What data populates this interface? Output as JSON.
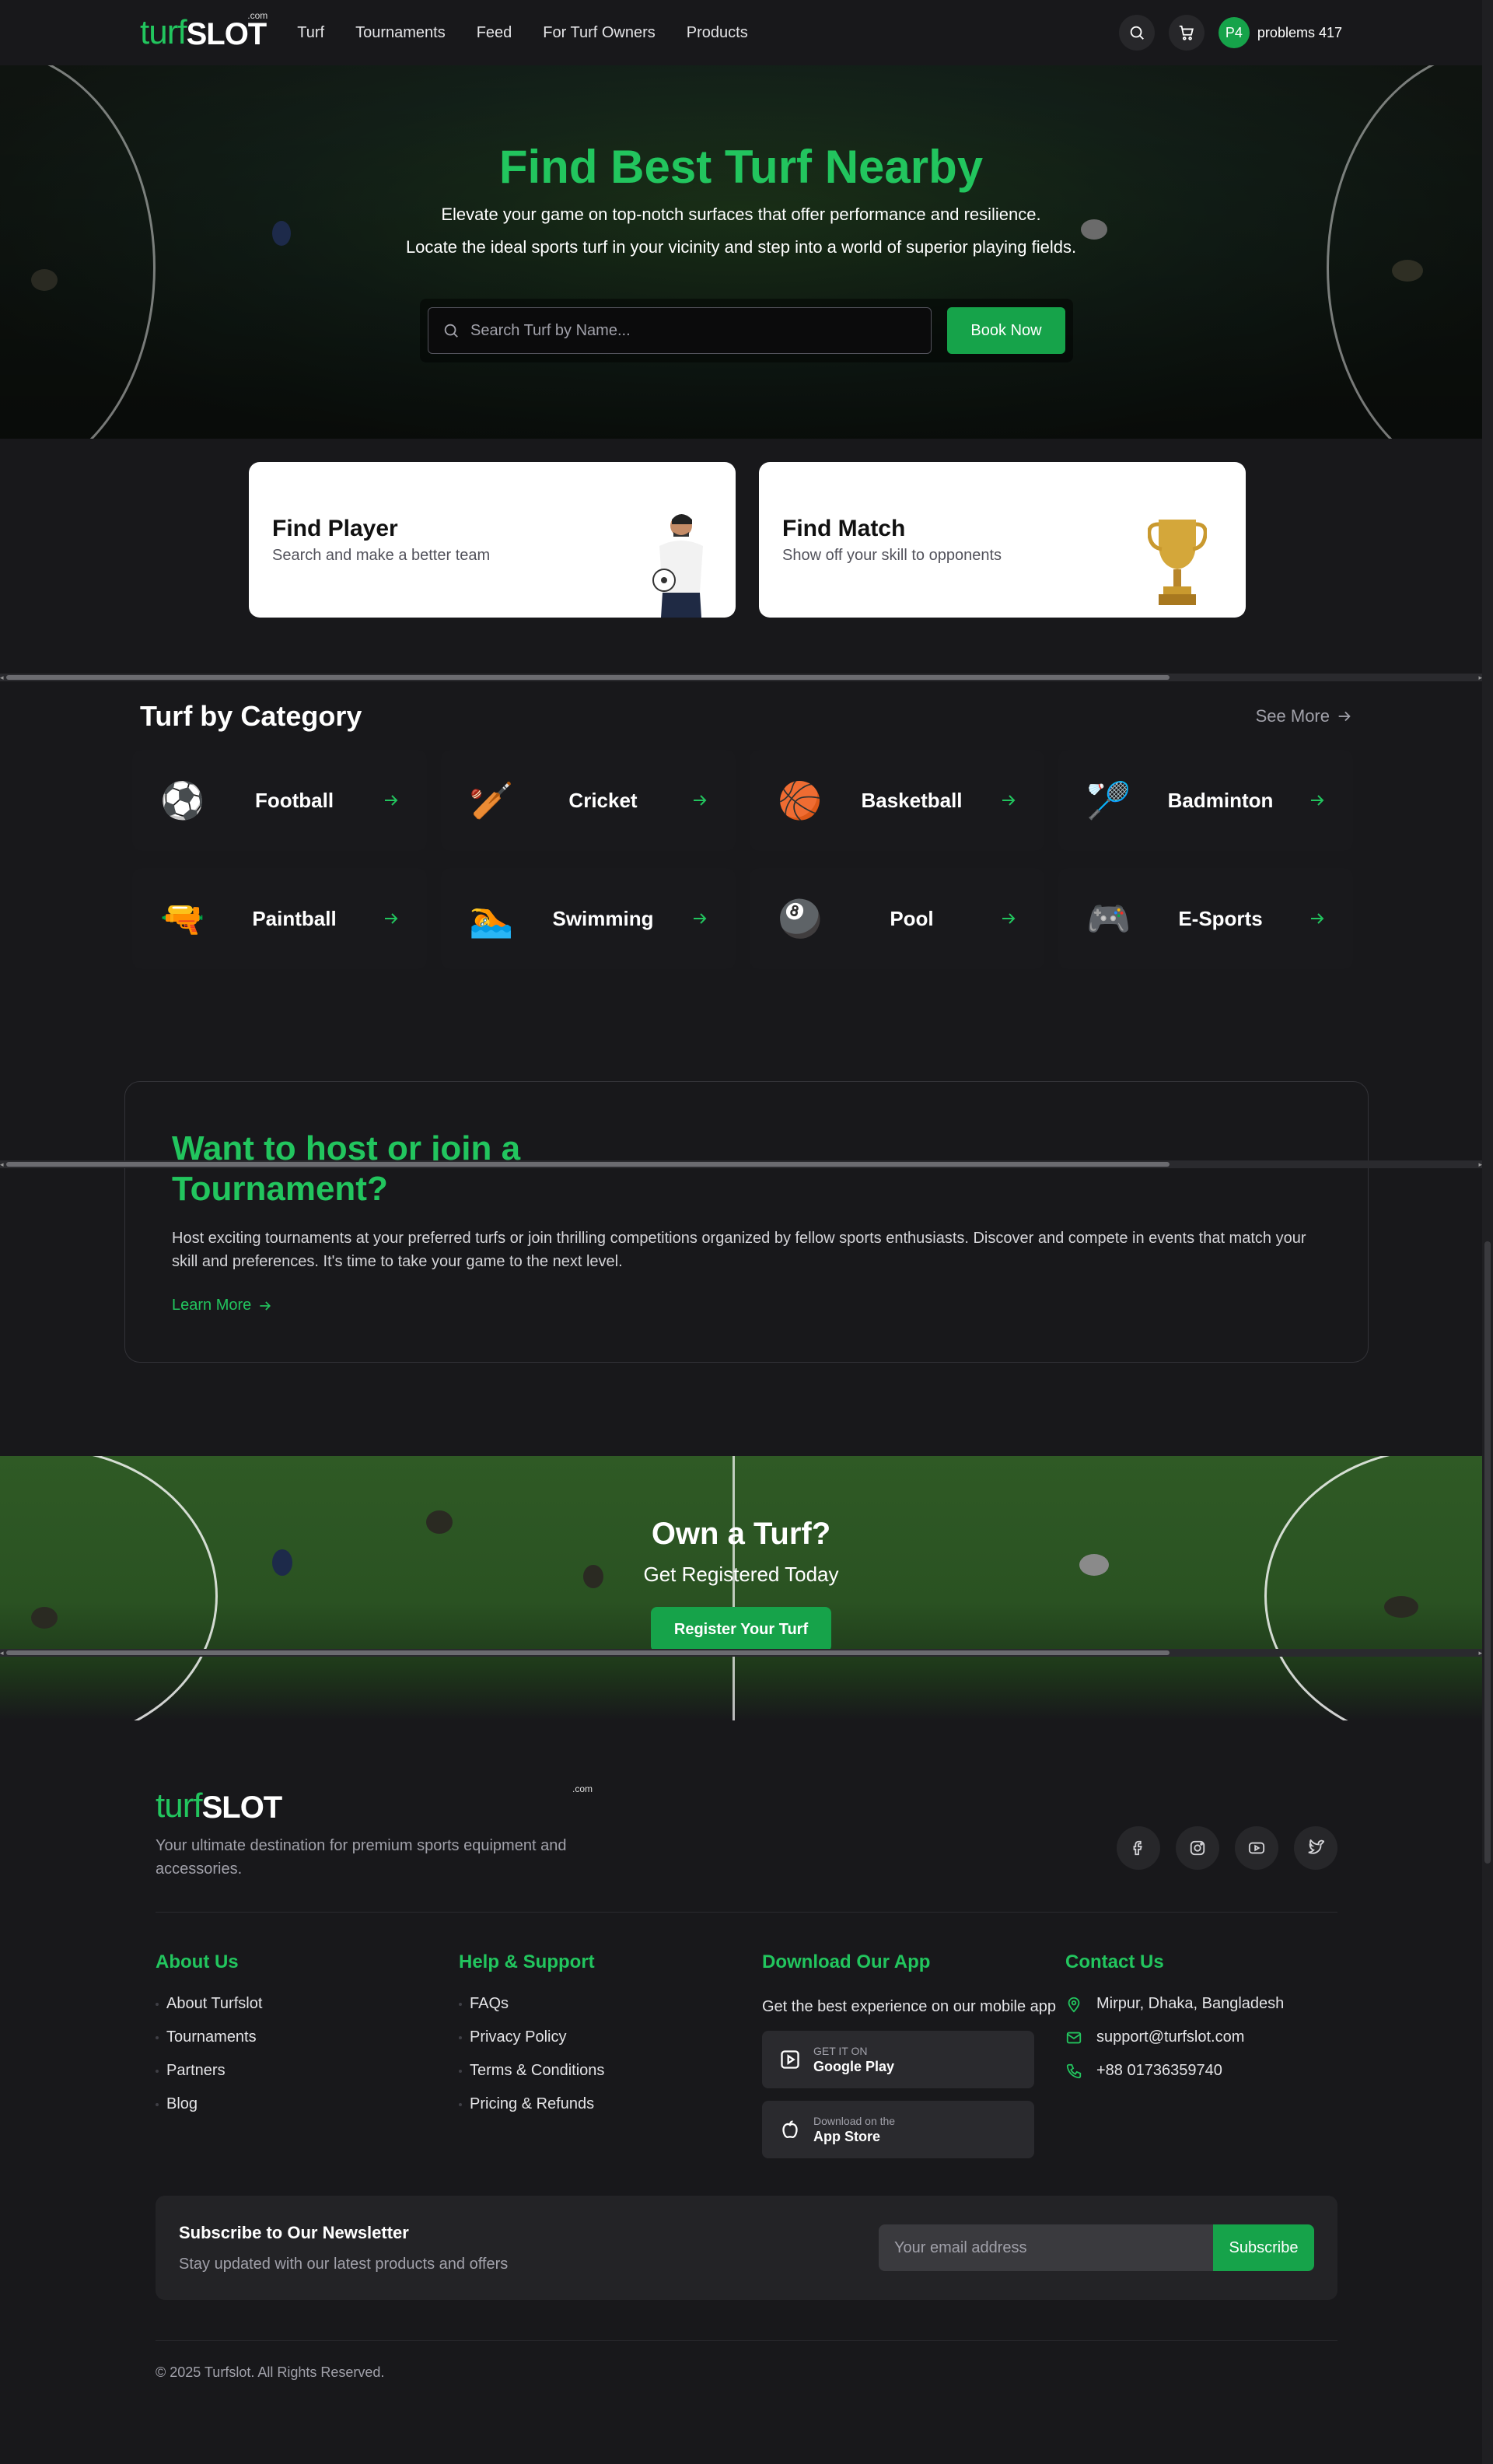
{
  "nav": {
    "logo_main": "turf",
    "logo_bold": "SLOT",
    "logo_suffix": ".com",
    "links": [
      "Turf",
      "Tournaments",
      "Feed",
      "For Turf Owners",
      "Products"
    ],
    "avatar_initials": "P4",
    "username": "problems 417"
  },
  "hero": {
    "title": "Find Best Turf Nearby",
    "subtitle1": "Elevate your game on top-notch surfaces that offer performance and resilience.",
    "subtitle2": "Locate the ideal sports turf in your vicinity and step into a world of superior playing fields.",
    "search_placeholder": "Search Turf by Name...",
    "button": "Book Now"
  },
  "cards": [
    {
      "title": "Find Player",
      "subtitle": "Search and make a better team",
      "icon": "player-image"
    },
    {
      "title": "Find Match",
      "subtitle": "Show off your skill to opponents",
      "icon": "trophy-icon"
    }
  ],
  "categories": {
    "title": "Turf by Category",
    "see_more": "See More",
    "items": [
      {
        "name": "Football",
        "icon": "⚽"
      },
      {
        "name": "Cricket",
        "icon": "🏏"
      },
      {
        "name": "Basketball",
        "icon": "🏀"
      },
      {
        "name": "Badminton",
        "icon": "🏸"
      },
      {
        "name": "Paintball",
        "icon": "🔫"
      },
      {
        "name": "Swimming",
        "icon": "🏊"
      },
      {
        "name": "Pool",
        "icon": "🎱"
      },
      {
        "name": "E-Sports",
        "icon": "🎮"
      }
    ]
  },
  "tournament": {
    "title": "Want to host or join a Tournament?",
    "body": "Host exciting tournaments at your preferred turfs or join thrilling competitions organized by fellow sports enthusiasts. Discover and compete in events that match your skill and preferences. It's time to take your game to the next level.",
    "link": "Learn More"
  },
  "own": {
    "title": "Own a Turf?",
    "subtitle": "Get Registered Today",
    "button": "Register Your Turf"
  },
  "footer": {
    "tagline": "Your ultimate destination for premium sports equipment and accessories.",
    "socials": [
      "facebook-icon",
      "instagram-icon",
      "youtube-icon",
      "twitter-icon"
    ],
    "about": {
      "title": "About Us",
      "items": [
        "About Turfslot",
        "Tournaments",
        "Partners",
        "Blog"
      ]
    },
    "help": {
      "title": "Help & Support",
      "items": [
        "FAQs",
        "Privacy Policy",
        "Terms & Conditions",
        "Pricing & Refunds"
      ]
    },
    "app": {
      "title": "Download Our App",
      "desc": "Get the best experience on our mobile app",
      "google_small": "GET IT ON",
      "google_big": "Google Play",
      "apple_small": "Download on the",
      "apple_big": "App Store"
    },
    "contact": {
      "title": "Contact Us",
      "address": "Mirpur, Dhaka, Bangladesh",
      "email": "support@turfslot.com",
      "phone": "+88 01736359740"
    },
    "newsletter": {
      "title": "Subscribe to Our Newsletter",
      "subtitle": "Stay updated with our latest products and offers",
      "placeholder": "Your email address",
      "button": "Subscribe"
    },
    "copyright": "© 2025 Turfslot. All Rights Reserved."
  },
  "colors": {
    "accent": "#22c55e",
    "button": "#16a34a",
    "background": "#18181b"
  }
}
